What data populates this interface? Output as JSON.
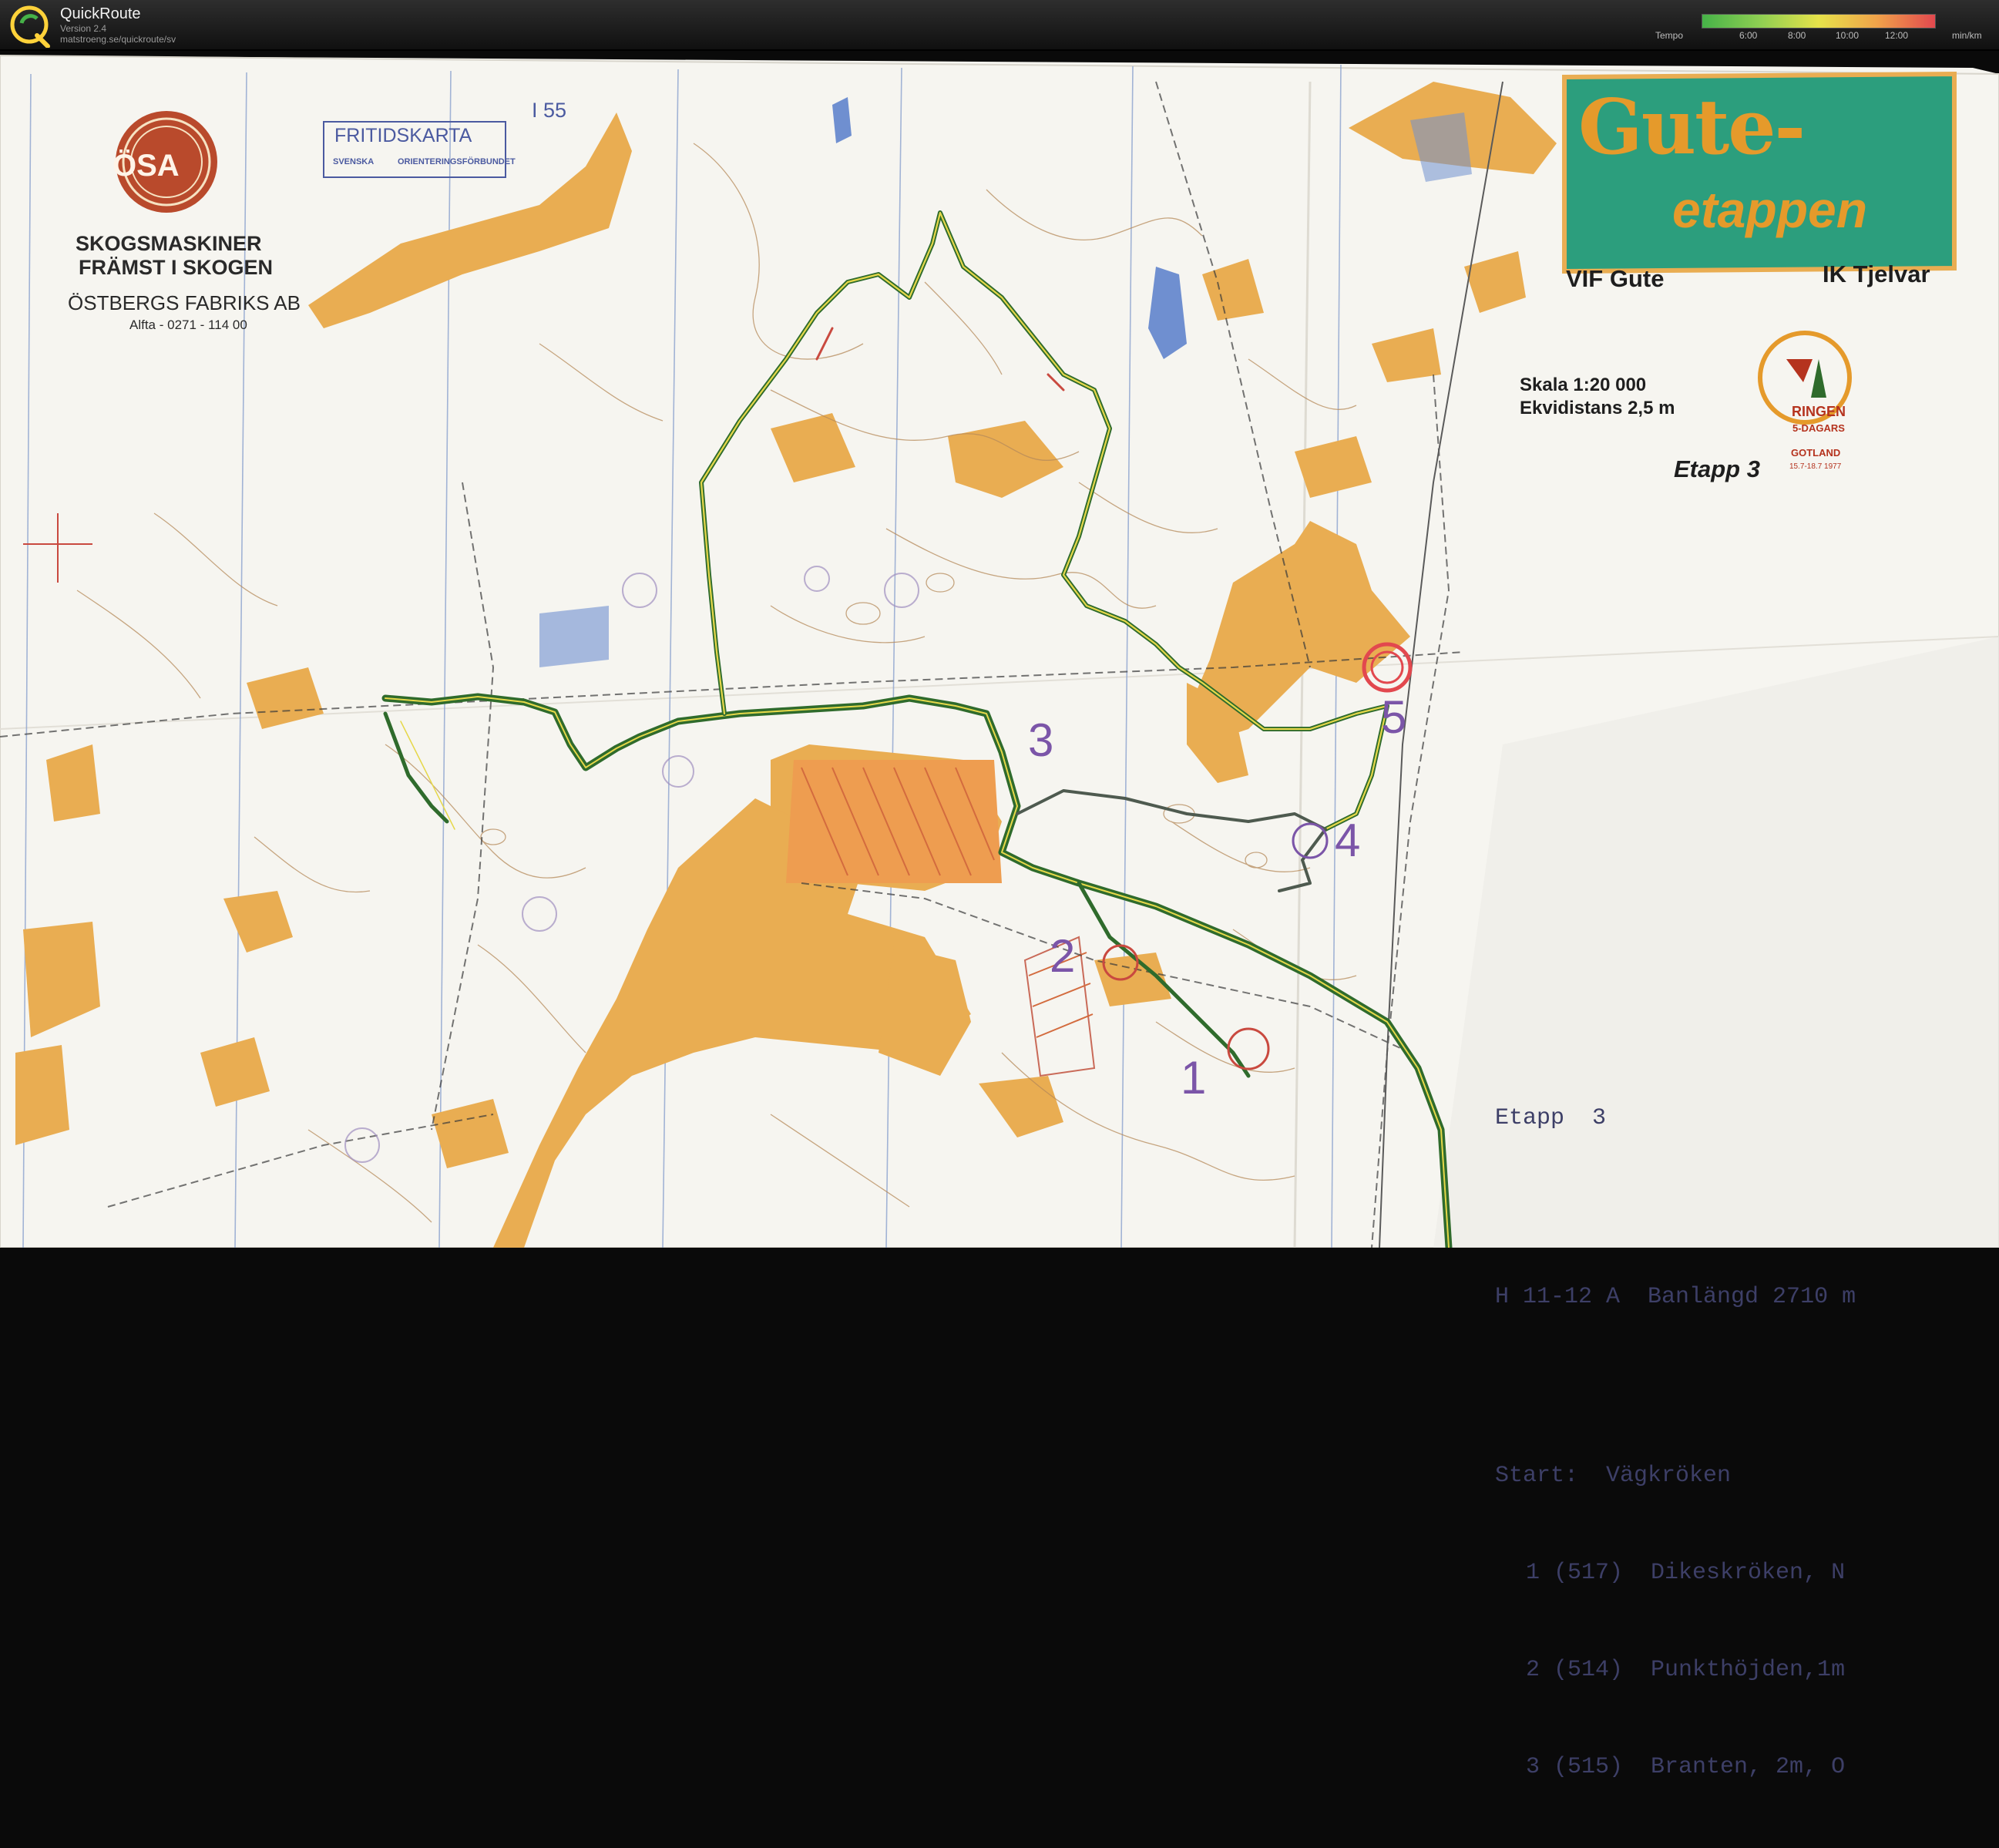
{
  "app": {
    "name": "QuickRoute",
    "version": "Version 2.4",
    "url": "matstroeng.se/quickroute/sv",
    "logo_letter": "Q"
  },
  "tempo_legend": {
    "label": "Tempo",
    "ticks": [
      "6:00",
      "8:00",
      "10:00",
      "12:00"
    ],
    "unit": "min/km",
    "colors": [
      "#46b248",
      "#8fcf52",
      "#e6e24a",
      "#f0a34a",
      "#e2484e"
    ]
  },
  "map": {
    "title": "Gute-",
    "subtitle": "etappen",
    "club_left": "VIF Gute",
    "club_right": "IK Tjelvar",
    "scale": "Skala 1:20 000",
    "contour_interval": "Ekvidistans 2,5 m",
    "stage": "Etapp 3",
    "ringen": {
      "name": "RINGEN",
      "event": "5-DAGARS",
      "region": "GOTLAND",
      "date": "15.7-18.7 1977"
    },
    "sponsor": {
      "logo_text": "ÖSA",
      "name": "SKOGSMASKINER",
      "tagline": "FRÄMST I SKOGEN",
      "company": "ÖSTBERGS FABRIKS AB",
      "phone": "Alfta - 0271 - 114 00"
    },
    "fritidskarta": {
      "title": "FRITIDSKARTA",
      "org_a": "SVENSKA",
      "org_b": "ORIENTERINGSFÖRBUNDET"
    },
    "sheet_number": "I 55",
    "controls": [
      "1",
      "2",
      "3",
      "4",
      "5"
    ],
    "course": {
      "stage_line": "Etapp  3",
      "class_line": "H 11-12 A  Banlängd 2710 m",
      "start_line": "Start:  Vägkröken",
      "legs": [
        "1 (517)  Dikeskröken, N",
        "2 (514)  Punkthöjden,1m",
        "3 (515)  Branten, 2m, O"
      ]
    },
    "colors": {
      "paper": "#f6f5f0",
      "open_land": "#e9ad52",
      "route_green": "#2f6b2c",
      "route_yellow": "#e6d84a",
      "control_red": "#c9493f",
      "course_purple": "#7b55a8",
      "water_blue": "#6f8fd0",
      "contour_brown": "#b58a5a",
      "header_box": "#2c9e7d"
    }
  }
}
